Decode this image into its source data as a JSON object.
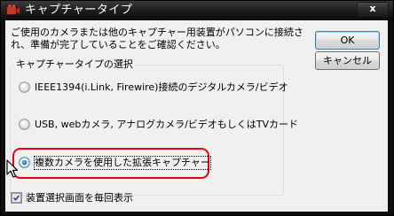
{
  "window": {
    "title": "キャプチャータイプ",
    "close_label": "x"
  },
  "description": "ご使用のカメラまたは他のキャプチャー用装置がパソコンに接続され、準備が完了していることをご確認ください。",
  "buttons": {
    "ok_label": "OK",
    "cancel_label": "キャンセル"
  },
  "capture_group": {
    "label": "キャプチャータイプの選択",
    "options": [
      {
        "label": "IEEE1394(i.Link, Firewire)接続のデジタルカメラ/ビデオ",
        "selected": false
      },
      {
        "label": "USB, webカメラ, アナログカメラ/ビデオもしくはTVカード",
        "selected": false
      },
      {
        "label": "複数カメラを使用した拡張キャプチャー",
        "selected": true
      }
    ]
  },
  "device_selection": {
    "label": "装置選択画面を毎回表示",
    "checked": true
  },
  "colors": {
    "highlight": "#e60012",
    "title_text": "#ffffff",
    "dialog_bg": "#f0f0f0"
  }
}
